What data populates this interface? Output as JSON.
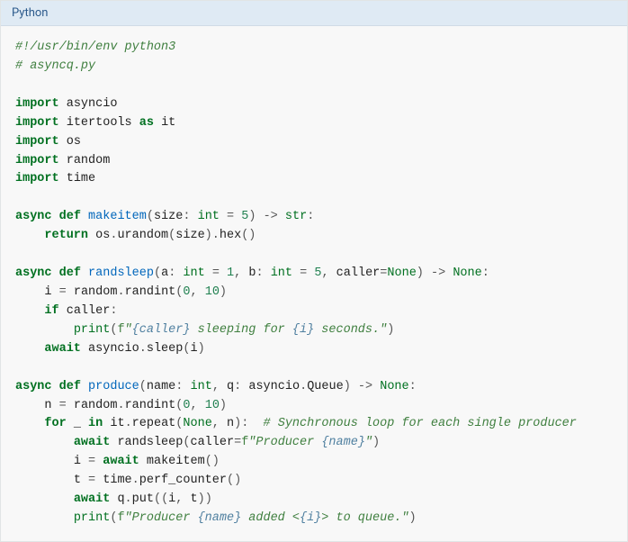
{
  "titlebar": "Python",
  "code": {
    "l01_shebang": "#!/usr/bin/env python3",
    "l02_comment": "# asyncq.py",
    "kw_import": "import",
    "kw_as": "as",
    "kw_async": "async",
    "kw_def": "def",
    "kw_return": "return",
    "kw_if": "if",
    "kw_for": "for",
    "kw_in": "in",
    "kw_await": "await",
    "mod_asyncio": "asyncio",
    "mod_itertools": "itertools",
    "alias_it": "it",
    "mod_os": "os",
    "mod_random": "random",
    "mod_time": "time",
    "fn_makeitem": "makeitem",
    "fn_randsleep": "randsleep",
    "fn_produce": "produce",
    "id_size": "size",
    "ty_int": "int",
    "num5": "5",
    "num1": "1",
    "num0": "0",
    "num10": "10",
    "ty_str": "str",
    "ty_None": "None",
    "id_os": "os",
    "m_urandom": "urandom",
    "m_hex": "hex",
    "id_a": "a",
    "id_b": "b",
    "id_caller": "caller",
    "id_i": "i",
    "id_t": "t",
    "id_n": "n",
    "id_q": "q",
    "id_name": "name",
    "id_random": "random",
    "m_randint": "randint",
    "fn_print": "print",
    "s_pre_f": "f",
    "s1a": "\"",
    "s1b": " sleeping for ",
    "s1c": " seconds.\"",
    "si_caller": "{caller}",
    "si_i": "{i}",
    "si_name": "{name}",
    "id_asyncio": "asyncio",
    "m_sleep": "sleep",
    "cls_Queue": "Queue",
    "id_underscore": "_",
    "id_it": "it",
    "m_repeat": "repeat",
    "c_prod_loop": "# Synchronous loop for each single producer",
    "s2a": "\"Producer ",
    "s2b": "\"",
    "id_time": "time",
    "m_perf_counter": "perf_counter",
    "m_put": "put",
    "s3a": "\"Producer ",
    "s3b": " added <",
    "s3c": "> to queue.\""
  }
}
